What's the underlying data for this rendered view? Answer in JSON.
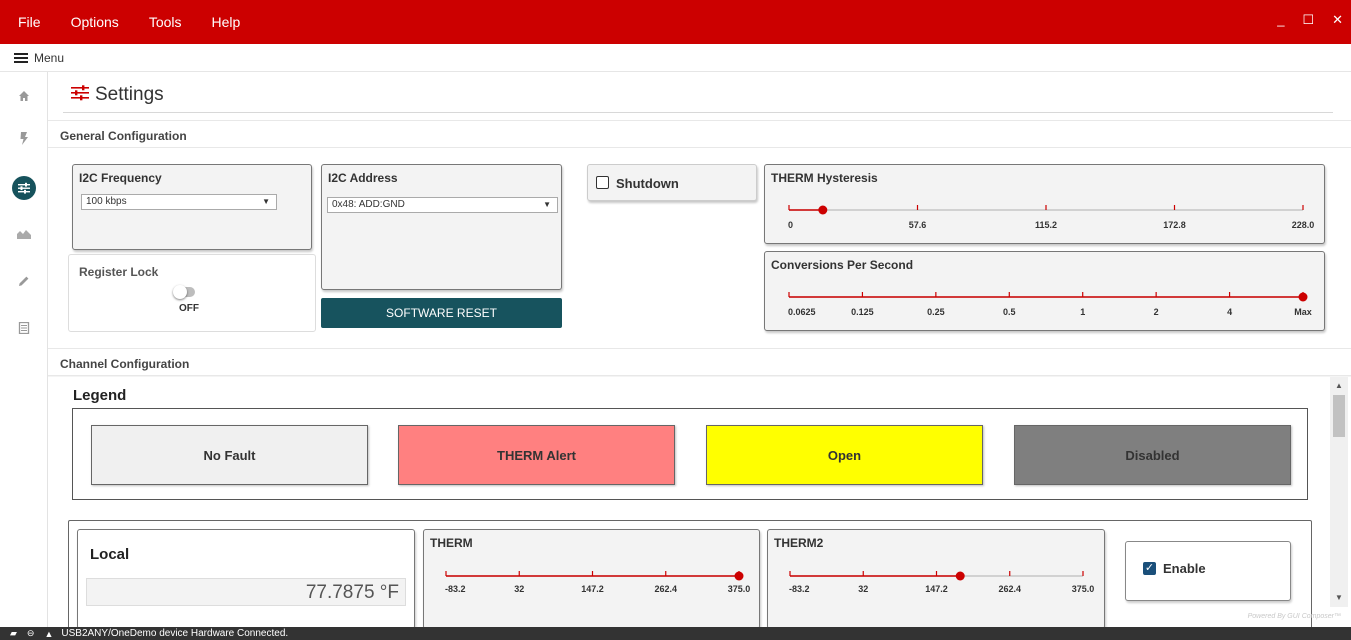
{
  "menubar": {
    "items": [
      "File",
      "Options",
      "Tools",
      "Help"
    ],
    "window_controls": [
      "_",
      "☐",
      "✕"
    ]
  },
  "menu_row": {
    "label": "Menu"
  },
  "nav": {
    "icons": [
      "home-icon",
      "bolt-icon",
      "settings-sliders-icon",
      "chart-area-icon",
      "pencil-icon",
      "register-list-icon"
    ],
    "active": "settings-sliders-icon"
  },
  "page": {
    "title": "Settings"
  },
  "general": {
    "section_title": "General Configuration",
    "i2c_frequency": {
      "title": "I2C Frequency",
      "value": "100 kbps"
    },
    "i2c_address": {
      "title": "I2C Address",
      "value": "0x48: ADD:GND"
    },
    "register_lock": {
      "title": "Register Lock",
      "state": "OFF"
    },
    "software_reset": "SOFTWARE RESET",
    "shutdown": {
      "label": "Shutdown",
      "checked": false
    },
    "therm_hysteresis": {
      "title": "THERM Hysteresis",
      "ticks": [
        "0",
        "57.6",
        "115.2",
        "172.8",
        "228.0"
      ],
      "value": 15,
      "min": 0,
      "max": 228
    },
    "conversions": {
      "title": "Conversions Per Second",
      "ticks": [
        "0.0625",
        "0.125",
        "0.25",
        "0.5",
        "1",
        "2",
        "4",
        "Max"
      ],
      "selected": "Max"
    }
  },
  "channel": {
    "section_title": "Channel Configuration",
    "legend": {
      "title": "Legend",
      "items": [
        {
          "label": "No Fault",
          "color": "#f0f0f0"
        },
        {
          "label": "THERM Alert",
          "color": "#ff8080"
        },
        {
          "label": "Open",
          "color": "#ffff00"
        },
        {
          "label": "Disabled",
          "color": "#7f7f7f"
        }
      ]
    },
    "local": {
      "title": "Local",
      "reading": "77.7875 °F",
      "therm": {
        "title": "THERM",
        "ticks": [
          "-83.2",
          "32",
          "147.2",
          "262.4",
          "375.0"
        ],
        "value": 375,
        "min": -83.2,
        "max": 375
      },
      "therm2": {
        "title": "THERM2",
        "ticks": [
          "-83.2",
          "32",
          "147.2",
          "262.4",
          "375.0"
        ],
        "value": 183,
        "min": -83.2,
        "max": 375
      },
      "enable": {
        "label": "Enable",
        "checked": true
      }
    }
  },
  "status": {
    "text": "USB2ANY/OneDemo device   Hardware Connected."
  },
  "footer": {
    "powered": "Powered By GUI Composer™"
  },
  "colors": {
    "brand_red": "#cc0000",
    "teal": "#16525c",
    "slider_red": "#cc0000"
  }
}
